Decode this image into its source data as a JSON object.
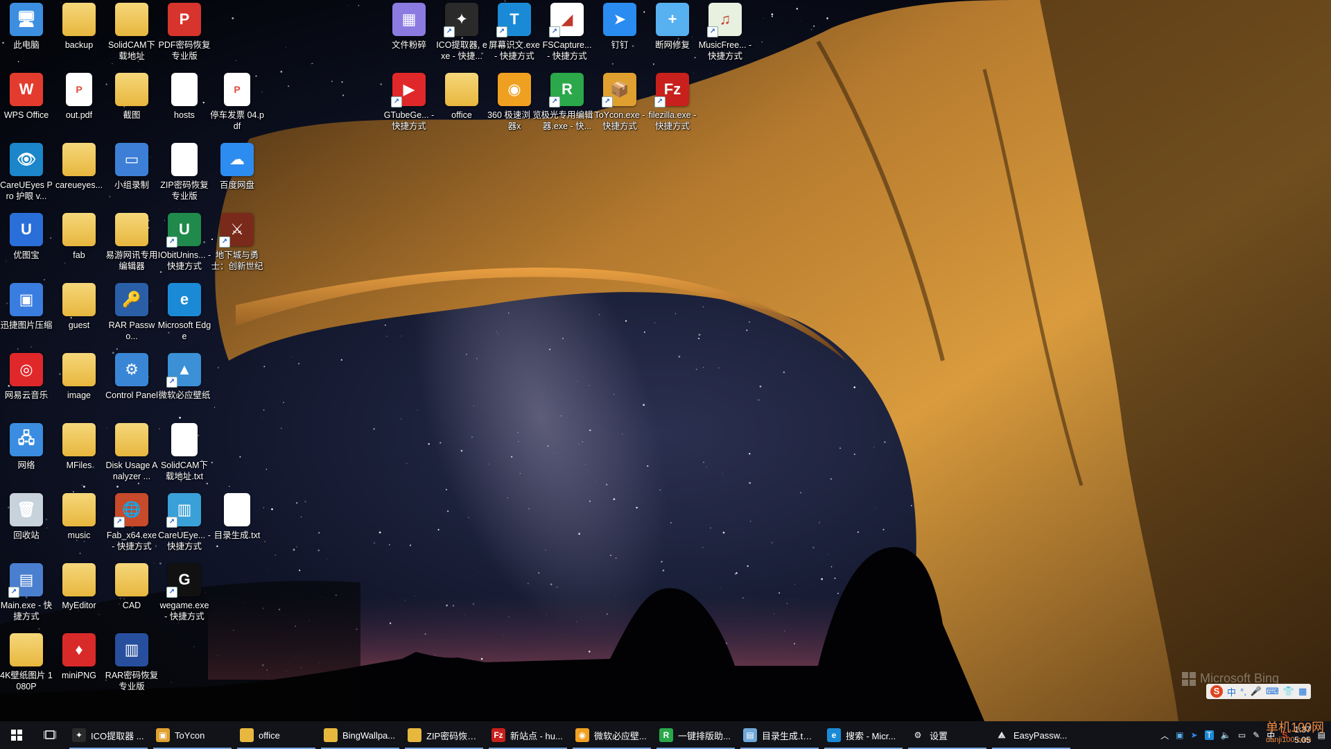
{
  "desktop_icons": [
    {
      "label": "此电脑",
      "icon": "computer-icon",
      "color": "#3c8ee0",
      "glyph": "🖥",
      "style": "plain"
    },
    {
      "label": "WPS Office",
      "icon": "wps-icon",
      "color": "#e43b2f",
      "glyph": "W",
      "style": "plain"
    },
    {
      "label": "CareUEyes Pro 护眼 v...",
      "icon": "eye-icon",
      "color": "#1b86c9",
      "glyph": "👁",
      "style": "plain"
    },
    {
      "label": "优图宝",
      "icon": "youtubao-icon",
      "color": "#2a6fd9",
      "glyph": "U",
      "style": "plain"
    },
    {
      "label": "迅捷图片压缩",
      "icon": "image-compress-icon",
      "color": "#3a7de0",
      "glyph": "▣",
      "style": "plain"
    },
    {
      "label": "网易云音乐",
      "icon": "netease-music-icon",
      "color": "#e0282a",
      "glyph": "◎",
      "style": "plain"
    },
    {
      "label": "网络",
      "icon": "network-icon",
      "color": "#3a8de0",
      "glyph": "🖧",
      "style": "plain"
    },
    {
      "label": "回收站",
      "icon": "recycle-bin-icon",
      "color": "#c7d2db",
      "glyph": "🗑",
      "style": "plain"
    },
    {
      "label": "Main.exe - 快捷方式",
      "icon": "main-exe-icon",
      "color": "#4a7fd0",
      "glyph": "▤",
      "style": "shortcut"
    },
    {
      "label": "4K壁纸图片 1080P",
      "icon": "folder-icon",
      "color": "",
      "glyph": "",
      "style": "folder"
    },
    {
      "label": "backup",
      "icon": "backup-folder-icon",
      "color": "",
      "glyph": "",
      "style": "folder"
    },
    {
      "label": "out.pdf",
      "icon": "pdf-file-icon",
      "color": "#e14b3a",
      "glyph": "P",
      "style": "doc"
    },
    {
      "label": "careueyes...",
      "icon": "folder-icon",
      "color": "",
      "glyph": "",
      "style": "folder"
    },
    {
      "label": "fab",
      "icon": "folder-icon",
      "color": "",
      "glyph": "",
      "style": "folder"
    },
    {
      "label": "guest",
      "icon": "folder-icon",
      "color": "",
      "glyph": "",
      "style": "folder"
    },
    {
      "label": "image",
      "icon": "folder-icon",
      "color": "",
      "glyph": "",
      "style": "folder"
    },
    {
      "label": "MFiles",
      "icon": "folder-icon",
      "color": "",
      "glyph": "",
      "style": "folder"
    },
    {
      "label": "music",
      "icon": "folder-icon",
      "color": "",
      "glyph": "",
      "style": "folder"
    },
    {
      "label": "MyEditor",
      "icon": "folder-icon",
      "color": "",
      "glyph": "",
      "style": "folder"
    },
    {
      "label": "miniPNG",
      "icon": "minipng-icon",
      "color": "#d92a2a",
      "glyph": "♦",
      "style": "plain"
    },
    {
      "label": "SolidCAM下 载地址",
      "icon": "folder-icon",
      "color": "",
      "glyph": "",
      "style": "folder"
    },
    {
      "label": "截图",
      "icon": "folder-icon",
      "color": "",
      "glyph": "",
      "style": "folder"
    },
    {
      "label": "小组录制",
      "icon": "recorder-icon",
      "color": "#3d7fd6",
      "glyph": "▭",
      "style": "plain"
    },
    {
      "label": "易游网讯专用 编辑器",
      "icon": "folder-icon",
      "color": "",
      "glyph": "",
      "style": "folder"
    },
    {
      "label": "RAR Passwo...",
      "icon": "rar-password-icon",
      "color": "#2a5fa8",
      "glyph": "🔑",
      "style": "plain"
    },
    {
      "label": "Control Panel",
      "icon": "control-panel-icon",
      "color": "#3a86d6",
      "glyph": "⚙",
      "style": "plain"
    },
    {
      "label": "Disk Usage Analyzer ...",
      "icon": "folder-icon",
      "color": "",
      "glyph": "",
      "style": "folder"
    },
    {
      "label": "Fab_x64.exe - 快捷方式",
      "icon": "fab-exe-icon",
      "color": "#c74a2a",
      "glyph": "🌐",
      "style": "shortcut"
    },
    {
      "label": "CAD",
      "icon": "folder-icon",
      "color": "",
      "glyph": "",
      "style": "folder"
    },
    {
      "label": "RAR密码恢复 专业版",
      "icon": "rar-recovery-icon",
      "color": "#274f9e",
      "glyph": "▥",
      "style": "plain"
    },
    {
      "label": "PDF密码恢复 专业版",
      "icon": "pdf-recovery-icon",
      "color": "#d6342c",
      "glyph": "P",
      "style": "plain"
    },
    {
      "label": "hosts",
      "icon": "text-file-icon",
      "color": "",
      "glyph": "",
      "style": "doc"
    },
    {
      "label": "ZIP密码恢复 专业版",
      "icon": "zip-recovery-icon",
      "color": "#ffffff",
      "glyph": "ZIP",
      "style": "doc"
    },
    {
      "label": "IObitUnins... - 快捷方式",
      "icon": "iobit-icon",
      "color": "#1f8a4c",
      "glyph": "U",
      "style": "shortcut"
    },
    {
      "label": "Microsoft Edge",
      "icon": "edge-icon",
      "color": "#1b8ad6",
      "glyph": "e",
      "style": "plain"
    },
    {
      "label": "微软必应壁纸",
      "icon": "bing-wallpaper-icon",
      "color": "#3b90d6",
      "glyph": "▲",
      "style": "shortcut"
    },
    {
      "label": "SolidCAM下 载地址.txt",
      "icon": "text-file-icon",
      "color": "",
      "glyph": "",
      "style": "doc"
    },
    {
      "label": "CareUEye... - 快捷方式",
      "icon": "careueyes-zip-icon",
      "color": "#3aa0d8",
      "glyph": "▥",
      "style": "shortcut"
    },
    {
      "label": "wegame.exe - 快捷方式",
      "icon": "wegame-icon",
      "color": "#111111",
      "glyph": "G",
      "style": "shortcut"
    },
    {
      "label": "停车发票 04.pdf",
      "icon": "pdf-file-icon",
      "color": "#e14b3a",
      "glyph": "P",
      "style": "doc"
    },
    {
      "label": "百度网盘",
      "icon": "baidu-netdisk-icon",
      "color": "#2d8cf0",
      "glyph": "☁",
      "style": "plain"
    },
    {
      "label": "地下城与勇 士：创新世纪",
      "icon": "dnf-game-icon",
      "color": "#7a2a1a",
      "glyph": "⚔",
      "style": "shortcut"
    },
    {
      "label": "目录生成.txt",
      "icon": "text-file-icon",
      "color": "",
      "glyph": "",
      "style": "doc"
    },
    {
      "label": "文件粉碎",
      "icon": "file-shredder-icon",
      "color": "#8b7be0",
      "glyph": "▦",
      "style": "plain"
    },
    {
      "label": "GTubeGe... - 快捷方式",
      "icon": "tubeget-icon",
      "color": "#e0282a",
      "glyph": "▶",
      "style": "shortcut"
    },
    {
      "label": "ICO提取器. exe - 快捷...",
      "icon": "ico-extractor-icon",
      "color": "#2a2a2a",
      "glyph": "✦",
      "style": "shortcut"
    },
    {
      "label": "office",
      "icon": "folder-icon",
      "color": "",
      "glyph": "",
      "style": "folder"
    },
    {
      "label": "屏幕识文.exe - 快捷方式",
      "icon": "ocr-icon",
      "color": "#1b8ad6",
      "glyph": "T",
      "style": "shortcut"
    },
    {
      "label": "360 极速浏 览器x",
      "icon": "360-browser-icon",
      "color": "#f0a020",
      "glyph": "◉",
      "style": "plain"
    },
    {
      "label": "FSCapture... - 快捷方式",
      "icon": "fscapture-icon",
      "color": "#ffffff",
      "glyph": "◢",
      "style": "shortcut"
    },
    {
      "label": "极光专用编辑 器.exe - 快...",
      "icon": "jiguang-editor-icon",
      "color": "#2aa84a",
      "glyph": "R",
      "style": "shortcut"
    },
    {
      "label": "钉钉",
      "icon": "dingtalk-icon",
      "color": "#2a8cf0",
      "glyph": "➤",
      "style": "plain"
    },
    {
      "label": "ToYcon.exe - 快捷方式",
      "icon": "toycon-icon",
      "color": "#e0a030",
      "glyph": "📦",
      "style": "shortcut"
    },
    {
      "label": "断网修复",
      "icon": "network-repair-icon",
      "color": "#57b0f0",
      "glyph": "+",
      "style": "plain"
    },
    {
      "label": "filezilla.exe - 快捷方式",
      "icon": "filezilla-icon",
      "color": "#c8201c",
      "glyph": "Fz",
      "style": "shortcut"
    },
    {
      "label": "MusicFree... - 快捷方式",
      "icon": "musicfree-icon",
      "color": "#e8f0e0",
      "glyph": "♫",
      "style": "shortcut"
    }
  ],
  "bing_watermark": "Microsoft Bing",
  "ime_bar": [
    "中",
    "°,",
    "🎤",
    "⌨",
    "👕",
    "▦"
  ],
  "taskbar": {
    "items": [
      {
        "label": "ICO提取器 ...",
        "icon": "ico-extractor-icon",
        "color": "#2a2a2a",
        "glyph": "✦"
      },
      {
        "label": "ToYcon",
        "icon": "toycon-icon",
        "color": "#e0a030",
        "glyph": "▣"
      },
      {
        "label": "office",
        "icon": "folder-icon",
        "color": "#e7b73e",
        "glyph": ""
      },
      {
        "label": "BingWallpa...",
        "icon": "folder-icon",
        "color": "#e7b73e",
        "glyph": ""
      },
      {
        "label": "ZIP密码恢复...",
        "icon": "folder-icon",
        "color": "#e7b73e",
        "glyph": ""
      },
      {
        "label": "新站点 - hu...",
        "icon": "filezilla-icon",
        "color": "#c8201c",
        "glyph": "Fz"
      },
      {
        "label": "微软必应壁...",
        "icon": "360-browser-icon",
        "color": "#f0a020",
        "glyph": "◉"
      },
      {
        "label": "一键排版助...",
        "icon": "jiguang-editor-icon",
        "color": "#2aa84a",
        "glyph": "R"
      },
      {
        "label": "目录生成.txt...",
        "icon": "notepad-icon",
        "color": "#6fa7d8",
        "glyph": "▤"
      },
      {
        "label": "搜索 - Micr...",
        "icon": "edge-icon",
        "color": "#1b8ad6",
        "glyph": "e"
      },
      {
        "label": "设置",
        "icon": "gear-icon",
        "color": "transparent",
        "glyph": "⚙"
      },
      {
        "label": "EasyPassw...",
        "icon": "easypassword-icon",
        "color": "transparent",
        "glyph": "⟁"
      }
    ],
    "tray_input": "中",
    "clock_line1": "1:37",
    "clock_line2": "5.05"
  },
  "watermark_text": "单机100网",
  "watermark_url": "danji100.com"
}
